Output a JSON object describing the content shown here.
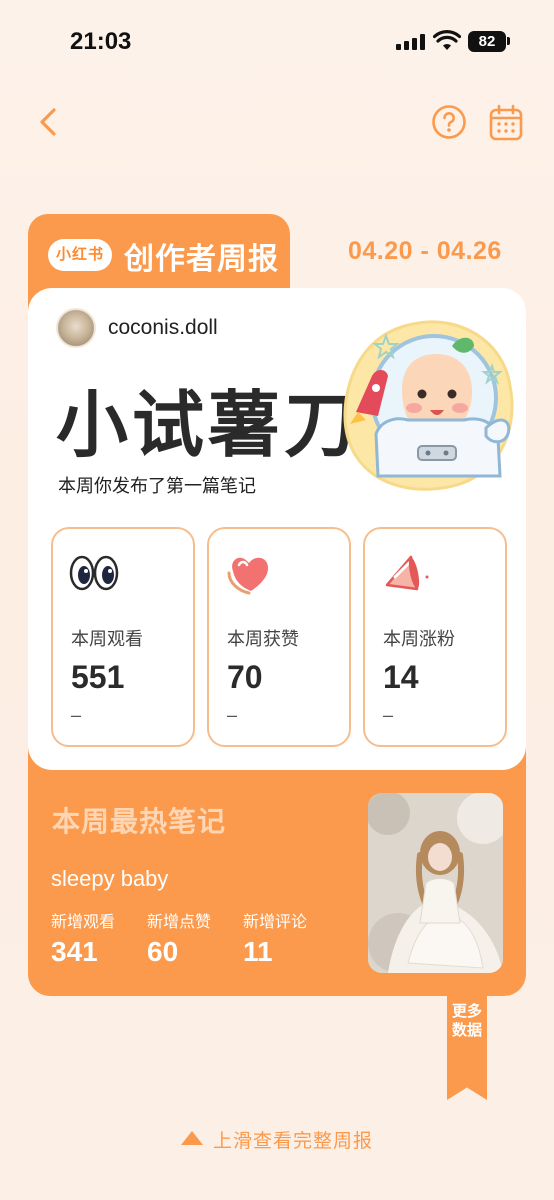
{
  "status_bar": {
    "time": "21:03",
    "battery": "82",
    "icons": [
      "signal-icon",
      "wifi-icon",
      "battery-icon"
    ]
  },
  "nav": {
    "icons": [
      "back-chevron-icon",
      "help-circle-icon",
      "calendar-icon"
    ]
  },
  "header": {
    "brand": "小红书",
    "title": "创作者周报",
    "date_range": "04.20 - 04.26"
  },
  "profile": {
    "username": "coconis.doll",
    "level_title": "小试薯刀",
    "subtitle": "本周你发布了第一篇笔记"
  },
  "stats": [
    {
      "icon": "eyes-icon",
      "label": "本周观看",
      "value": "551",
      "delta": "–"
    },
    {
      "icon": "heart-like-icon",
      "label": "本周获赞",
      "value": "70",
      "delta": "–"
    },
    {
      "icon": "megaphone-icon",
      "label": "本周涨粉",
      "value": "14",
      "delta": "–"
    }
  ],
  "hot_note": {
    "section_title": "本周最热笔记",
    "note_title": "sleepy baby",
    "metrics": [
      {
        "label": "新增观看",
        "value": "341"
      },
      {
        "label": "新增点赞",
        "value": "60"
      },
      {
        "label": "新增评论",
        "value": "11"
      }
    ]
  },
  "more_data": "更多数据",
  "swipe_hint": "上滑查看完整周报",
  "colors": {
    "accent": "#fb9a4c",
    "card_border": "#f6be8d",
    "background": "#fdf2ea"
  }
}
